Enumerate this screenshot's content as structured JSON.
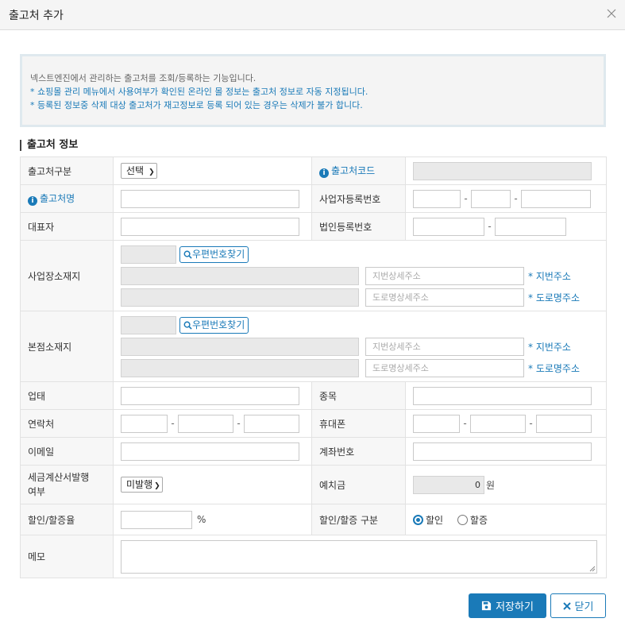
{
  "dialog": {
    "title": "출고처 추가"
  },
  "info": {
    "line0": "넥스트엔진에서 관리하는 출고처를 조회/등록하는 기능입니다.",
    "line1": "* 쇼핑몰 관리 메뉴에서 사용여부가 확인된 온라인 몰 정보는 출고처 정보로 자동 지정됩니다.",
    "line2": "* 등록된 정보중 삭제 대상 출고처가 재고정보로 등록 되어 있는 경우는 삭제가 불가 합니다."
  },
  "section": {
    "title": "출고처 정보"
  },
  "form": {
    "type_label": "출고처구분",
    "type_value": "선택",
    "code_label": "출고처코드",
    "name_label": "출고처명",
    "bizno_label": "사업자등록번호",
    "ceo_label": "대표자",
    "corpno_label": "법인등록번호",
    "biz_addr_label": "사업장소재지",
    "hq_addr_label": "본점소재지",
    "zip_button": "우편번호찾기",
    "jibun_placeholder": "지번상세주소",
    "road_placeholder": "도로명상세주소",
    "jibun_note": "* 지번주소",
    "road_note": "* 도로명주소",
    "biztype_label": "업태",
    "bizitem_label": "종목",
    "phone_label": "연락처",
    "mobile_label": "휴대폰",
    "email_label": "이메일",
    "account_label": "계좌번호",
    "tax_label_line1": "세금계산서발행",
    "tax_label_line2": "여부",
    "tax_value": "미발행",
    "deposit_label": "예치금",
    "deposit_value": "0",
    "deposit_unit": "원",
    "rate_label": "할인/할증율",
    "rate_unit": "%",
    "kind_label": "할인/할증 구분",
    "kind_options": [
      "할인",
      "할증"
    ],
    "kind_selected": "할인",
    "memo_label": "메모"
  },
  "buttons": {
    "save": "저장하기",
    "close": "닫기"
  },
  "colors": {
    "accent": "#1a7ab8",
    "label_bg": "#f7f7f7",
    "info_bg": "#f4f4f4"
  }
}
